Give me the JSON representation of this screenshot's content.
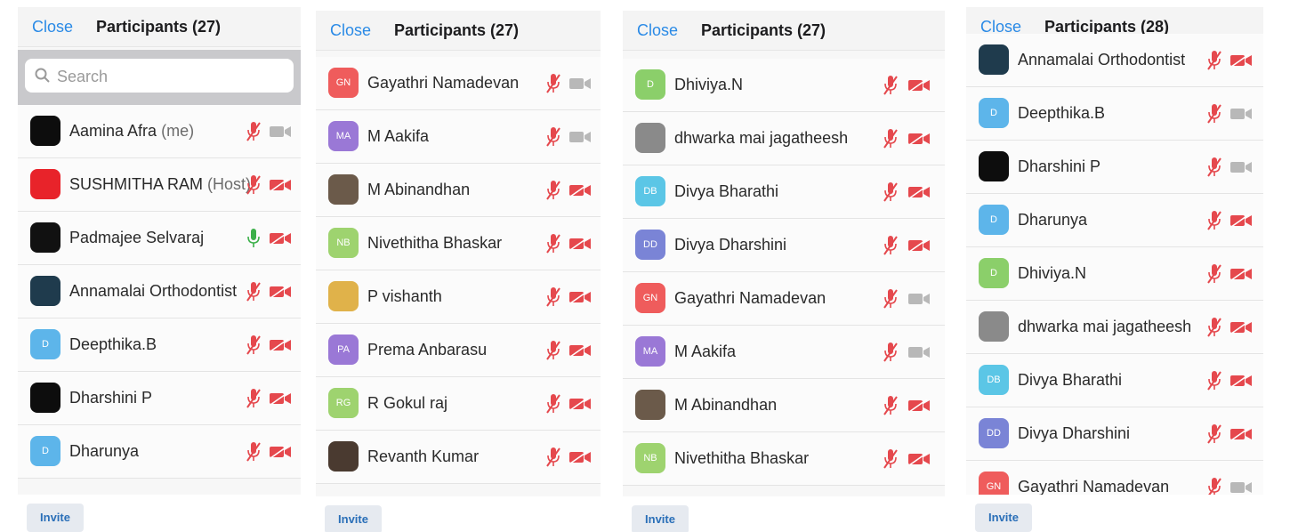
{
  "colors": {
    "accent": "#2a8ae6",
    "muted_red": "#e5484d",
    "unmuted_green": "#3cb04a",
    "camera_off": "#b8b8b8"
  },
  "panels": [
    {
      "close_label": "Close",
      "title": "Participants (27)",
      "search": {
        "placeholder": "Search"
      },
      "invite_label": "Invite",
      "participants": [
        {
          "name": "Aamina Afra",
          "role": "(me)",
          "initials": "",
          "avatar_color": "#0d0d0d",
          "mic": "muted",
          "video": "gray"
        },
        {
          "name": "SUSHMITHA RAM",
          "role": "(Host)",
          "initials": "",
          "avatar_color": "#e8232a",
          "mic": "muted",
          "video": "red"
        },
        {
          "name": "Padmajee Selvaraj",
          "role": "",
          "initials": "",
          "avatar_color": "#111111",
          "mic": "on",
          "video": "red"
        },
        {
          "name": "Annamalai Orthodontist",
          "role": "",
          "initials": "",
          "avatar_color": "#1f3b4d",
          "mic": "muted",
          "video": "red"
        },
        {
          "name": "Deepthika.B",
          "role": "",
          "initials": "D",
          "avatar_color": "#5db5ea",
          "mic": "muted",
          "video": "red"
        },
        {
          "name": "Dharshini P",
          "role": "",
          "initials": "",
          "avatar_color": "#0d0d0d",
          "mic": "muted",
          "video": "red"
        },
        {
          "name": "Dharunya",
          "role": "",
          "initials": "D",
          "avatar_color": "#5db5ea",
          "mic": "muted",
          "video": "red"
        }
      ]
    },
    {
      "close_label": "Close",
      "title": "Participants (27)",
      "invite_label": "Invite",
      "participants": [
        {
          "name": "Gayathri Namadevan",
          "role": "",
          "initials": "GN",
          "avatar_color": "#ef5c5c",
          "mic": "muted",
          "video": "gray"
        },
        {
          "name": "M Aakifa",
          "role": "",
          "initials": "MA",
          "avatar_color": "#9a78d6",
          "mic": "muted",
          "video": "gray"
        },
        {
          "name": "M Abinandhan",
          "role": "",
          "initials": "",
          "avatar_color": "#6b5a4a",
          "mic": "muted",
          "video": "red"
        },
        {
          "name": "Nivethitha Bhaskar",
          "role": "",
          "initials": "NB",
          "avatar_color": "#9ed36f",
          "mic": "muted",
          "video": "red"
        },
        {
          "name": "P vishanth",
          "role": "",
          "initials": "",
          "avatar_color": "#e0b24a",
          "mic": "muted",
          "video": "red"
        },
        {
          "name": "Prema Anbarasu",
          "role": "",
          "initials": "PA",
          "avatar_color": "#9a78d6",
          "mic": "muted",
          "video": "red"
        },
        {
          "name": "R Gokul raj",
          "role": "",
          "initials": "RG",
          "avatar_color": "#9ed36f",
          "mic": "muted",
          "video": "red"
        },
        {
          "name": "Revanth Kumar",
          "role": "",
          "initials": "",
          "avatar_color": "#4a3a30",
          "mic": "muted",
          "video": "red"
        }
      ]
    },
    {
      "close_label": "Close",
      "title": "Participants (27)",
      "invite_label": "Invite",
      "participants": [
        {
          "name": "Dhiviya.N",
          "role": "",
          "initials": "D",
          "avatar_color": "#8bcf6a",
          "mic": "muted",
          "video": "red"
        },
        {
          "name": "dhwarka mai jagatheesh",
          "role": "",
          "initials": "",
          "avatar_color": "#8a8a8a",
          "mic": "muted",
          "video": "red"
        },
        {
          "name": "Divya Bharathi",
          "role": "",
          "initials": "DB",
          "avatar_color": "#5bc6e6",
          "mic": "muted",
          "video": "red"
        },
        {
          "name": "Divya Dharshini",
          "role": "",
          "initials": "DD",
          "avatar_color": "#7a84d6",
          "mic": "muted",
          "video": "red"
        },
        {
          "name": "Gayathri Namadevan",
          "role": "",
          "initials": "GN",
          "avatar_color": "#ef5c5c",
          "mic": "muted",
          "video": "gray"
        },
        {
          "name": "M Aakifa",
          "role": "",
          "initials": "MA",
          "avatar_color": "#9a78d6",
          "mic": "muted",
          "video": "gray"
        },
        {
          "name": "M Abinandhan",
          "role": "",
          "initials": "",
          "avatar_color": "#6b5a4a",
          "mic": "muted",
          "video": "red"
        },
        {
          "name": "Nivethitha Bhaskar",
          "role": "",
          "initials": "NB",
          "avatar_color": "#9ed36f",
          "mic": "muted",
          "video": "red"
        }
      ]
    },
    {
      "close_label": "Close",
      "title": "Participants (28)",
      "invite_label": "Invite",
      "participants": [
        {
          "name": "Annamalai Orthodontist",
          "role": "",
          "initials": "",
          "avatar_color": "#1f3b4d",
          "mic": "muted",
          "video": "red"
        },
        {
          "name": "Deepthika.B",
          "role": "",
          "initials": "D",
          "avatar_color": "#5db5ea",
          "mic": "muted",
          "video": "gray"
        },
        {
          "name": "Dharshini P",
          "role": "",
          "initials": "",
          "avatar_color": "#0d0d0d",
          "mic": "muted",
          "video": "gray"
        },
        {
          "name": "Dharunya",
          "role": "",
          "initials": "D",
          "avatar_color": "#5db5ea",
          "mic": "muted",
          "video": "red"
        },
        {
          "name": "Dhiviya.N",
          "role": "",
          "initials": "D",
          "avatar_color": "#8bcf6a",
          "mic": "muted",
          "video": "red"
        },
        {
          "name": "dhwarka mai jagatheesh",
          "role": "",
          "initials": "",
          "avatar_color": "#8a8a8a",
          "mic": "muted",
          "video": "red"
        },
        {
          "name": "Divya Bharathi",
          "role": "",
          "initials": "DB",
          "avatar_color": "#5bc6e6",
          "mic": "muted",
          "video": "red"
        },
        {
          "name": "Divya Dharshini",
          "role": "",
          "initials": "DD",
          "avatar_color": "#7a84d6",
          "mic": "muted",
          "video": "red"
        },
        {
          "name": "Gayathri Namadevan",
          "role": "",
          "initials": "GN",
          "avatar_color": "#ef5c5c",
          "mic": "muted",
          "video": "gray"
        }
      ]
    }
  ]
}
